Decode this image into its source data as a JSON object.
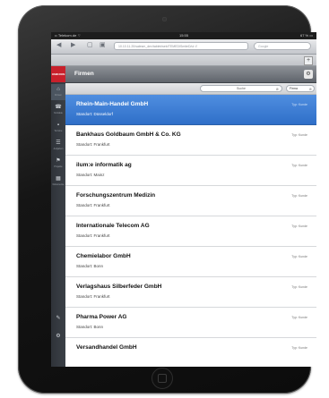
{
  "status_bar": {
    "carrier": "•• Telekom.de ⌔",
    "time": "15:55",
    "battery": "67 % ▭"
  },
  "browser": {
    "back_icon": "◀",
    "forward_icon": "▶",
    "bookmarks_icon": "▢",
    "tabs_icon": "▣",
    "url": "10.10.11.20/salesm_dev/tablet/web/TEMEDISmiteD/ui ↺",
    "google_placeholder": "Google",
    "plus_label": "+"
  },
  "app": {
    "logo_text": "OMIKRON",
    "sidebar": [
      {
        "icon": "⌂",
        "caption": "Firmen"
      },
      {
        "icon": "☎",
        "caption": "Kontakte"
      },
      {
        "icon": "▪",
        "caption": "Termine"
      },
      {
        "icon": "☰",
        "caption": "Aufgaben"
      },
      {
        "icon": "⚑",
        "caption": "Projekte"
      },
      {
        "icon": "▦",
        "caption": "Dokumente"
      }
    ],
    "sidebar_bottom": [
      {
        "icon": "✎"
      },
      {
        "icon": "⚙"
      }
    ],
    "title": "Firmen",
    "settings_icon": "⚙",
    "search_label": "Suche",
    "search_clear": "⊗",
    "filter_label": "Firma",
    "filter_clear": "⊗",
    "companies": [
      {
        "name": "Rhein-Main-Handel GmbH",
        "location": "Standort: Düsseldorf",
        "type": "Typ: Kunde",
        "selected": true
      },
      {
        "name": "Bankhaus Goldbaum GmbH & Co. KG",
        "location": "Standort: Frankfurt",
        "type": "Typ: Kunde"
      },
      {
        "name": "ilum:e informatik ag",
        "location": "Standort: Mainz",
        "type": "Typ: Kunde"
      },
      {
        "name": "Forschungszentrum Medizin",
        "location": "Standort: Frankfurt",
        "type": "Typ: Kunde"
      },
      {
        "name": "Internationale Telecom AG",
        "location": "Standort: Frankfurt",
        "type": "Typ: Kunde"
      },
      {
        "name": "Chemielabor GmbH",
        "location": "Standort: Bonn",
        "type": "Typ: Kunde"
      },
      {
        "name": "Verlagshaus Silberfeder GmbH",
        "location": "Standort: Frankfurt",
        "type": "Typ: Kunde"
      },
      {
        "name": "Pharma Power AG",
        "location": "Standort: Bonn",
        "type": "Typ: Kunde"
      },
      {
        "name": "Versandhandel GmbH",
        "location": "",
        "type": "Typ: Kunde"
      }
    ]
  }
}
